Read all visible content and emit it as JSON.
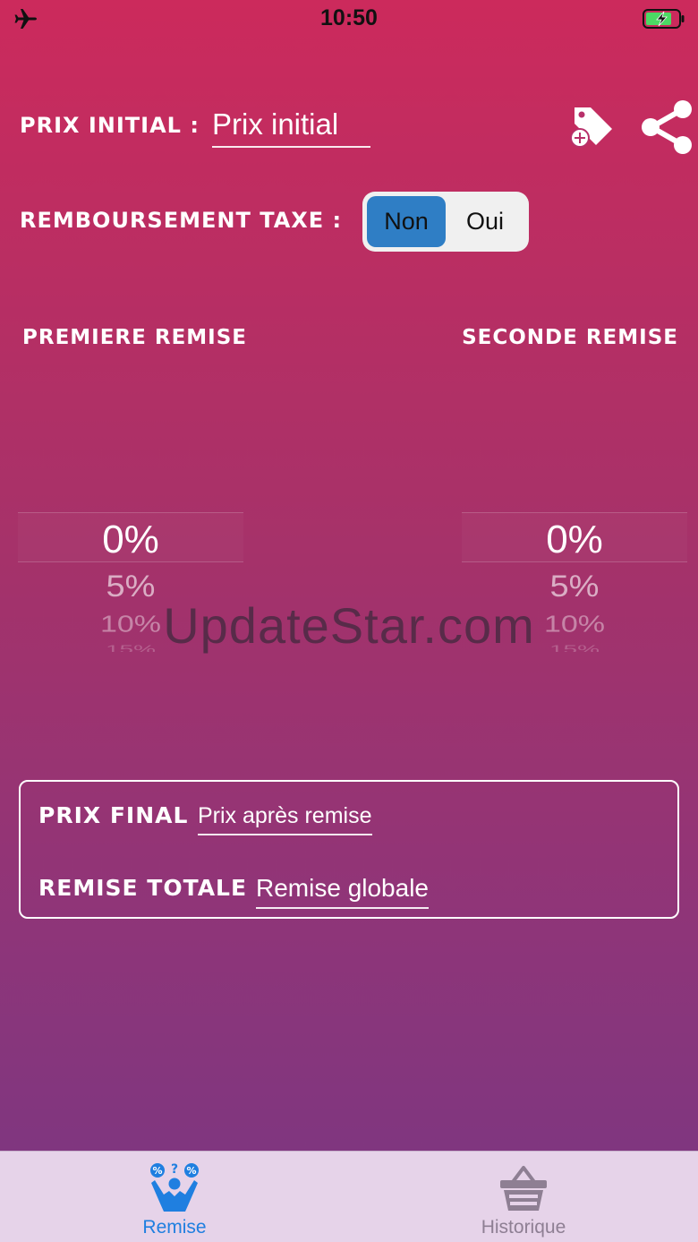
{
  "status_bar": {
    "time": "10:50",
    "left_icon": "airplane-icon",
    "right_icon": "battery-charging-icon"
  },
  "header": {
    "prix_initial_label": "PRIX INITIAL :",
    "prix_initial_placeholder": "Prix initial",
    "actions": [
      "tag-add-icon",
      "share-icon"
    ]
  },
  "taxe": {
    "label": "REMBOURSEMENT TAXE :",
    "options": [
      "Non",
      "Oui"
    ],
    "selected": "Non"
  },
  "remises": {
    "premiere_label": "PREMIERE REMISE",
    "seconde_label": "SECONDE REMISE",
    "premiere_values": [
      "0%",
      "5%",
      "10%",
      "15%"
    ],
    "seconde_values": [
      "0%",
      "5%",
      "10%",
      "15%"
    ]
  },
  "watermark": "UpdateStar.com",
  "results": {
    "prix_final_label": "PRIX FINAL",
    "prix_final_placeholder": "Prix après remise",
    "remise_totale_label": "REMISE TOTALE",
    "remise_totale_placeholder": "Remise globale"
  },
  "tabs": [
    {
      "label": "Remise",
      "icon": "remise-person-icon",
      "active": true
    },
    {
      "label": "Historique",
      "icon": "basket-icon",
      "active": false
    }
  ],
  "colors": {
    "gradient_top": "#cc2a5c",
    "gradient_bottom": "#7a3782",
    "segment_active": "#2f7ec5",
    "tab_active": "#1f7fe0",
    "tab_inactive": "#8e7f93",
    "tab_bar_bg": "#e6d3e9"
  }
}
